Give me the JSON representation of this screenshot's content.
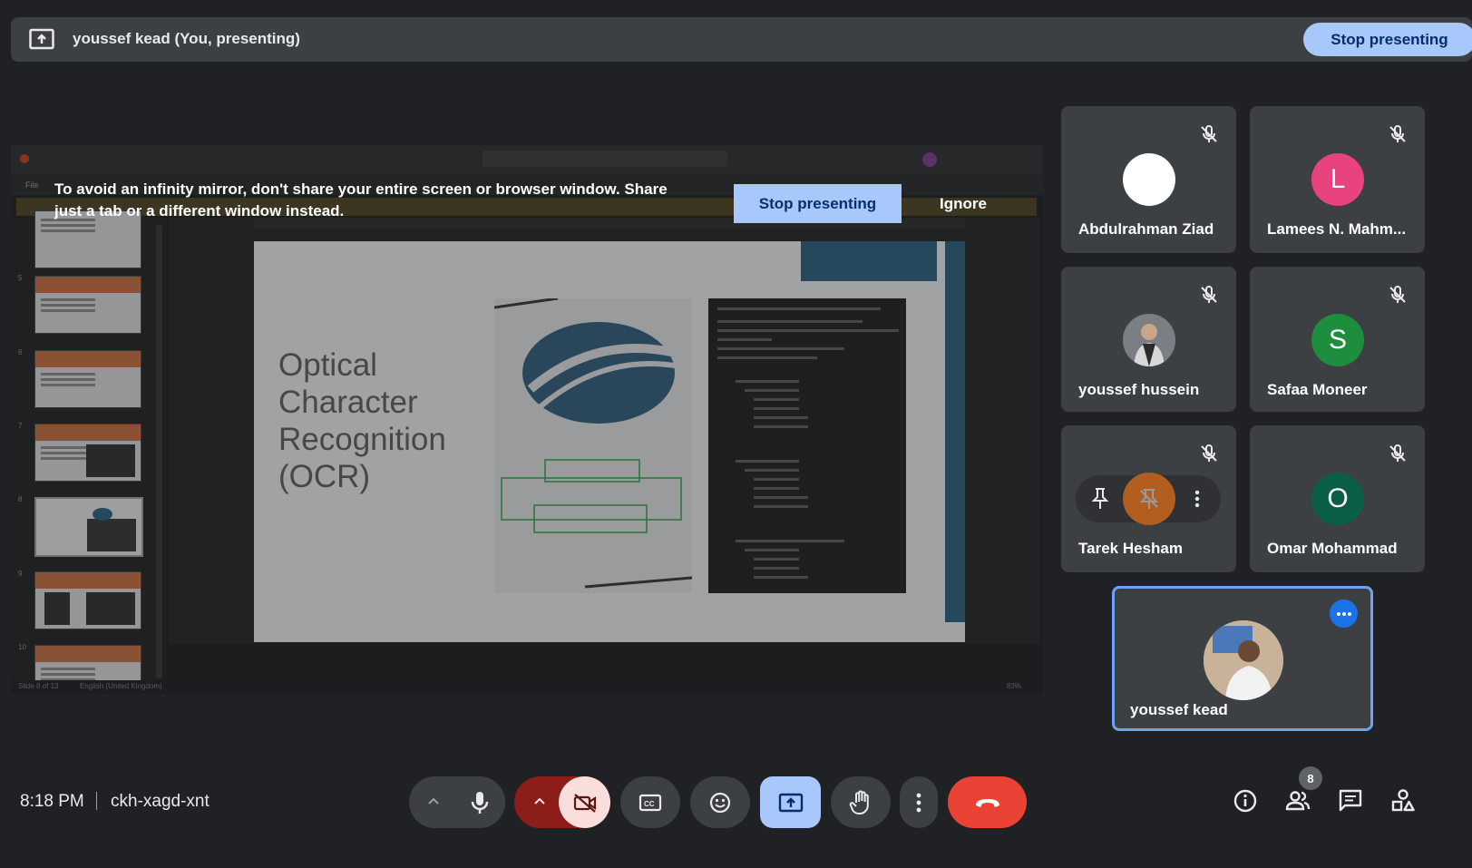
{
  "top_bar": {
    "presenter_label": "youssef kead (You, presenting)",
    "stop_presenting": "Stop presenting"
  },
  "warning": {
    "message": "To avoid an infinity mirror, don't share your entire screen or browser window. Share just a tab or a different window instead.",
    "stop_presenting": "Stop presenting",
    "ignore": "Ignore"
  },
  "shared_screen": {
    "app_menu_file": "File",
    "slide_title": "Optical Character Recognition (OCR)",
    "thumbnail_numbers": [
      "5",
      "6",
      "7",
      "8",
      "9",
      "10"
    ],
    "status_slide": "Slide 8 of 13",
    "status_language": "English (United Kingdom)",
    "zoom": "83%"
  },
  "participants": [
    {
      "name": "Abdulrahman Ziad",
      "initial": "",
      "avatar_color": "#ffffff",
      "muted": true
    },
    {
      "name": "Lamees N. Mahm...",
      "initial": "L",
      "avatar_color": "#e8437e",
      "muted": true
    },
    {
      "name": "youssef hussein",
      "initial": "",
      "avatar_color": "#6b6f73",
      "muted": true
    },
    {
      "name": "Safaa Moneer",
      "initial": "S",
      "avatar_color": "#1e8e3e",
      "muted": true
    },
    {
      "name": "Tarek Hesham",
      "initial": "",
      "avatar_color": "#b25e1e",
      "muted": true
    },
    {
      "name": "Omar Mohammad",
      "initial": "O",
      "avatar_color": "#0b5e46",
      "muted": true
    }
  ],
  "self": {
    "name": "youssef kead"
  },
  "bottom_bar": {
    "time": "8:18 PM",
    "meeting_code": "ckh-xagd-xnt",
    "participant_count": "8"
  },
  "colors": {
    "accent": "#a8c7fa",
    "end_call": "#ea4335",
    "camera_off": "#f9dedc",
    "camera_chevron": "#8c1d18",
    "present_active": "#a8c7fa"
  }
}
